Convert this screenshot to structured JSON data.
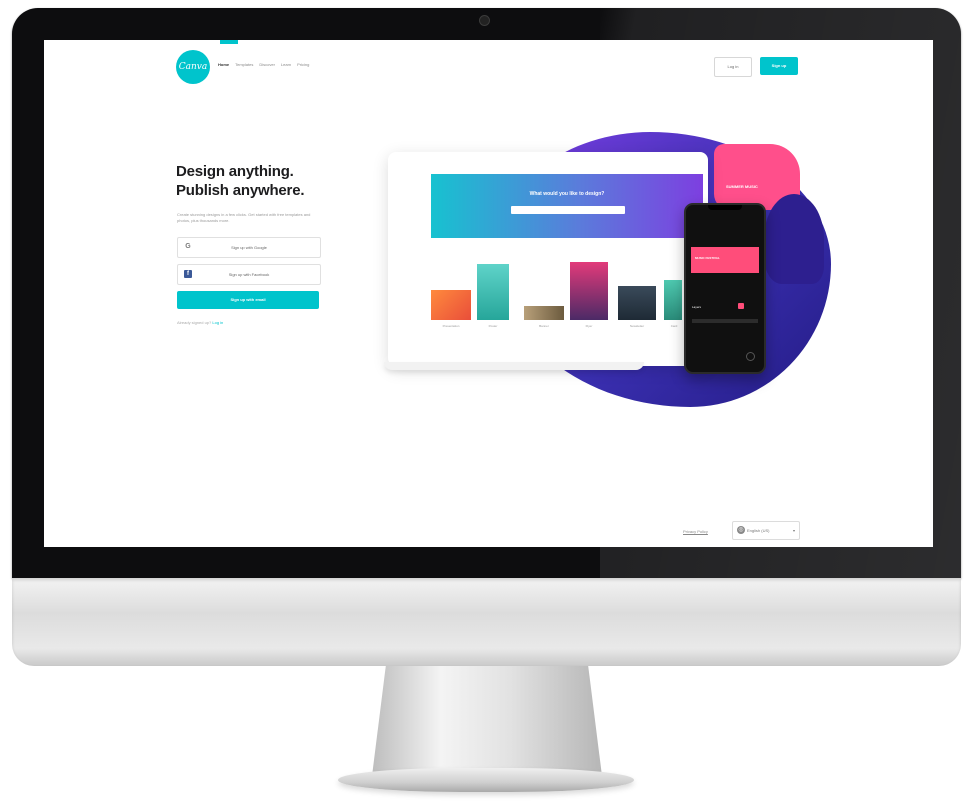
{
  "brand": {
    "logo_text": "Canva",
    "accent_color": "#00c4cc"
  },
  "nav": {
    "items": [
      "Home",
      "Templates",
      "Discover",
      "Learn",
      "Pricing"
    ],
    "login_label": "Log in",
    "signup_label": "Sign up"
  },
  "hero": {
    "headline_line1": "Design anything.",
    "headline_line2": "Publish anywhere.",
    "subtext": "Create stunning designs in a few clicks. Get started with free templates and photos, plus thousands more.",
    "google_button": "Sign up with Google",
    "facebook_button": "Sign up with Facebook",
    "email_button": "Sign up with email",
    "login_prompt": "Already signed up?",
    "login_link": "Log in"
  },
  "illustration": {
    "search_title": "What would you like to design?",
    "search_placeholder": "",
    "thumbnail_labels": [
      "Presentation",
      "Poster",
      "Banner",
      "Flyer",
      "Newsletter",
      "Card"
    ],
    "phone_banner_text": "MUSIC FESTIVAL",
    "phone_caption": "Layers",
    "panel_text": "SUMMER MUSIC"
  },
  "footer": {
    "privacy_label": "Privacy Policy",
    "language_label": "English (US)",
    "globe_icon": "globe-icon"
  }
}
